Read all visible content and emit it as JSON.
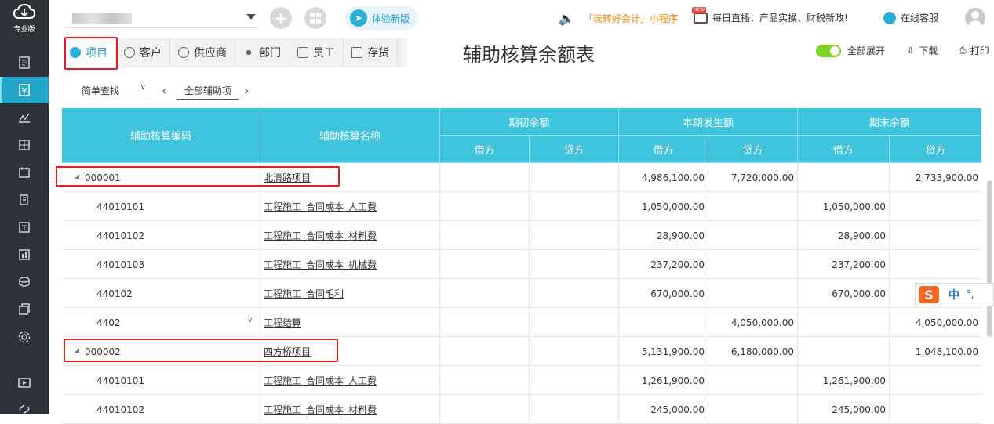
{
  "sidebar": {
    "edition": "专业版",
    "items": [
      "document-icon",
      "voucher-icon",
      "chart-icon",
      "ledger-icon",
      "calendar-icon",
      "book-icon",
      "tax-icon",
      "report-icon",
      "coin-icon",
      "copy-icon",
      "settings-icon",
      "video-icon",
      "link-icon"
    ]
  },
  "topbar": {
    "try_new": "体验新版",
    "promo": "「玩转好会计」小程序",
    "live": "每日直播：产品实操、财税新政!",
    "live_badge": "NEW",
    "customer_service": "在线客服"
  },
  "tabs": [
    "项目",
    "客户",
    "供应商",
    "部门",
    "员工",
    "存货"
  ],
  "page_title": "辅助核算余额表",
  "toolbar": {
    "expand_all": "全部展开",
    "download": "下载",
    "print": "打印"
  },
  "filter": {
    "query_mode": "简单查找",
    "aux_all": "全部辅助项"
  },
  "table": {
    "headers": {
      "code": "辅助核算编码",
      "name": "辅助核算名称",
      "opening": "期初余额",
      "period": "本期发生额",
      "closing": "期末余额",
      "debit": "借方",
      "credit": "贷方"
    },
    "rows": [
      {
        "level": 0,
        "code": "000001",
        "name": "北清路项目",
        "od": "",
        "oc": "",
        "pd": "4,986,100.00",
        "pc": "7,720,000.00",
        "cd": "",
        "cc": "2,733,900.00"
      },
      {
        "level": 1,
        "code": "44010101",
        "name": "工程施工_合同成本_人工费",
        "od": "",
        "oc": "",
        "pd": "1,050,000.00",
        "pc": "",
        "cd": "1,050,000.00",
        "cc": ""
      },
      {
        "level": 1,
        "code": "44010102",
        "name": "工程施工_合同成本_材料费",
        "od": "",
        "oc": "",
        "pd": "28,900.00",
        "pc": "",
        "cd": "28,900.00",
        "cc": ""
      },
      {
        "level": 1,
        "code": "44010103",
        "name": "工程施工_合同成本_机械费",
        "od": "",
        "oc": "",
        "pd": "237,200.00",
        "pc": "",
        "cd": "237,200.00",
        "cc": ""
      },
      {
        "level": 1,
        "code": "440102",
        "name": "工程施工_合同毛利",
        "od": "",
        "oc": "",
        "pd": "670,000.00",
        "pc": "",
        "cd": "670,000.00",
        "cc": ""
      },
      {
        "level": 1,
        "code": "4402",
        "name": "工程结算",
        "od": "",
        "oc": "",
        "pd": "",
        "pc": "4,050,000.00",
        "cd": "",
        "cc": "4,050,000.00"
      },
      {
        "level": 0,
        "code": "000002",
        "name": "四方桥项目",
        "od": "",
        "oc": "",
        "pd": "5,131,900.00",
        "pc": "6,180,000.00",
        "cd": "",
        "cc": "1,048,100.00"
      },
      {
        "level": 1,
        "code": "44010101",
        "name": "工程施工_合同成本_人工费",
        "od": "",
        "oc": "",
        "pd": "1,261,900.00",
        "pc": "",
        "cd": "1,261,900.00",
        "cc": ""
      },
      {
        "level": 1,
        "code": "44010102",
        "name": "工程施工_合同成本_材料费",
        "od": "",
        "oc": "",
        "pd": "245,000.00",
        "pc": "",
        "cd": "245,000.00",
        "cc": ""
      }
    ]
  },
  "ime": {
    "mode": "中",
    "punct": "°,"
  }
}
